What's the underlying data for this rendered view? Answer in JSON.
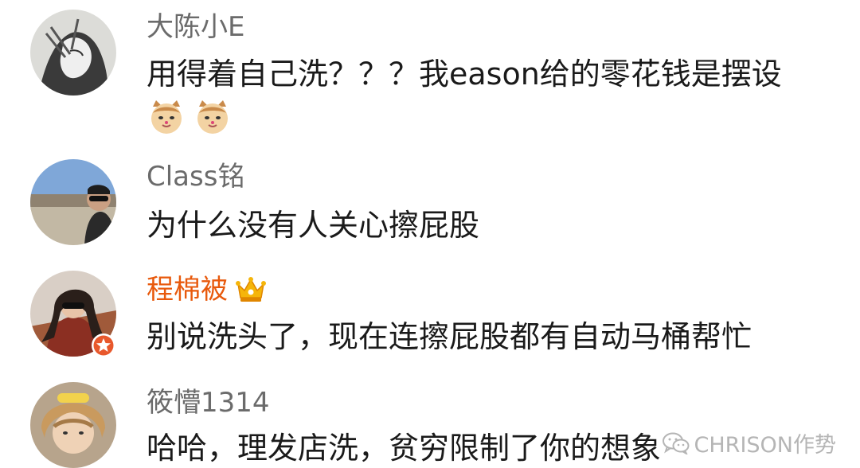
{
  "comments": [
    {
      "username": "大陈小E",
      "text": "用得着自己洗？？？我eason给的零花钱是摆设",
      "emojis": [
        "cat-face-icon",
        "cat-face-icon"
      ]
    },
    {
      "username": "Class铭",
      "text": "为什么没有人关心擦屁股"
    },
    {
      "username": "程棉被",
      "text": "别说洗头了，现在连擦屁股都有自动马桶帮忙",
      "badges": [
        "crown-icon",
        "vip-star-badge"
      ],
      "accent": "#e8590c"
    },
    {
      "username": "筱懵1314",
      "text": "哈哈，理发店洗，贫穷限制了你的想象"
    }
  ],
  "watermark": {
    "text": "CHRISON作势",
    "icon": "wechat-icon"
  }
}
